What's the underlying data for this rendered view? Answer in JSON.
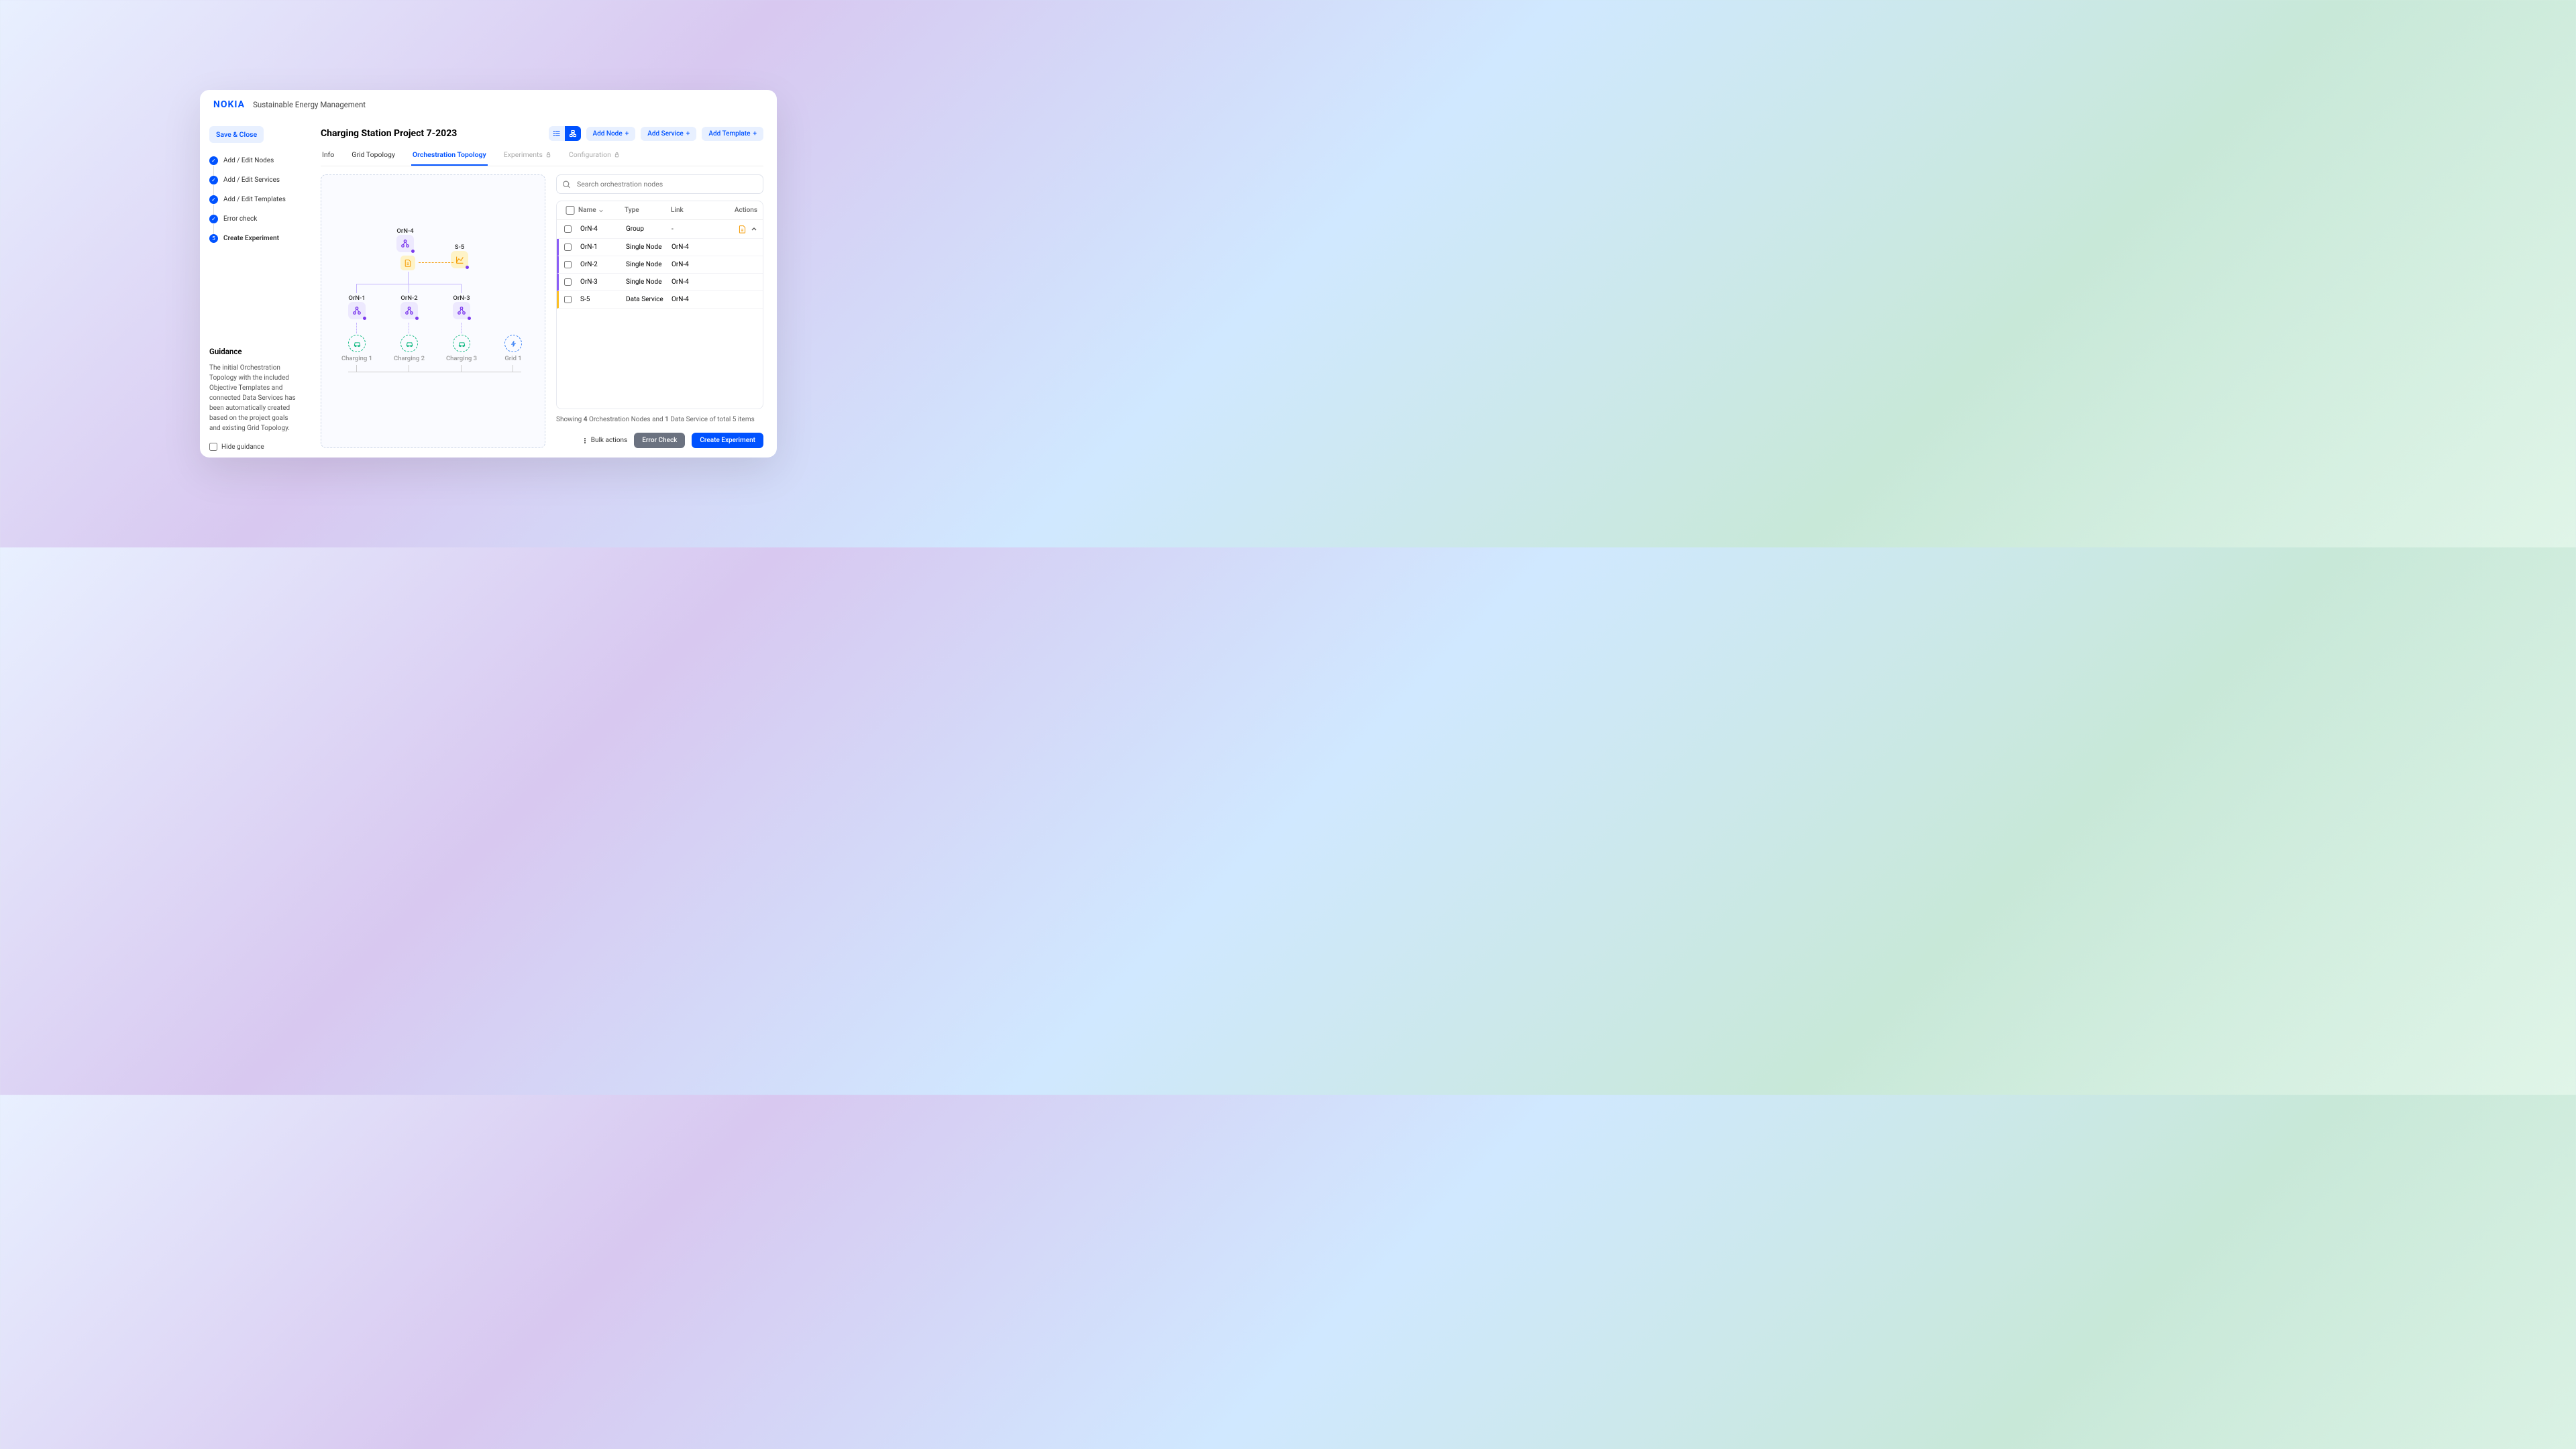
{
  "brand": "NOKIA",
  "app_title": "Sustainable Energy Management",
  "save_close": "Save & Close",
  "steps": [
    {
      "label": "Add / Edit Nodes",
      "done": true
    },
    {
      "label": "Add / Edit Services",
      "done": true
    },
    {
      "label": "Add / Edit Templates",
      "done": true
    },
    {
      "label": "Error check",
      "done": true
    },
    {
      "label": "Create Experiment",
      "done": false,
      "active": true,
      "num": "5"
    }
  ],
  "guidance": {
    "title": "Guidance",
    "body": "The initial Orchestration Topology with the included Objective Templates and connected Data Services has been automatically created based on the project goals and existing Grid Topology.",
    "hide_label": "Hide guidance"
  },
  "page_title": "Charging Station Project 7-2023",
  "header_buttons": {
    "add_node": "Add Node",
    "add_service": "Add Service",
    "add_template": "Add Template"
  },
  "tabs": [
    {
      "label": "Info"
    },
    {
      "label": "Grid Topology"
    },
    {
      "label": "Orchestration Topology",
      "active": true
    },
    {
      "label": "Experiments",
      "locked": true
    },
    {
      "label": "Configuration",
      "locked": true
    }
  ],
  "search_placeholder": "Search orchestration nodes",
  "table": {
    "headers": {
      "name": "Name",
      "type": "Type",
      "link": "Link",
      "actions": "Actions"
    },
    "rows": [
      {
        "name": "OrN-4",
        "type": "Group",
        "link": "-",
        "lv": 0,
        "expandable": true,
        "doc": true
      },
      {
        "name": "OrN-1",
        "type": "Single Node",
        "link": "OrN-4",
        "lv": 1
      },
      {
        "name": "OrN-2",
        "type": "Single Node",
        "link": "OrN-4",
        "lv": 1
      },
      {
        "name": "OrN-3",
        "type": "Single Node",
        "link": "OrN-4",
        "lv": 1
      },
      {
        "name": "S-5",
        "type": "Data Service",
        "link": "OrN-4",
        "lv": 2
      }
    ]
  },
  "topology": {
    "root": "OrN-4",
    "service": "S-5",
    "children": [
      "OrN-1",
      "OrN-2",
      "OrN-3"
    ],
    "leaves": [
      "Charging 1",
      "Charging 2",
      "Charging 3",
      "Grid 1"
    ]
  },
  "footer_text": {
    "pre": "Showing ",
    "n1": "4",
    "mid": " Orchestration Nodes and ",
    "n2": "1",
    "post": " Data Service of total 5 items"
  },
  "footer_actions": {
    "bulk": "Bulk actions",
    "error": "Error Check",
    "create": "Create Experiment"
  }
}
